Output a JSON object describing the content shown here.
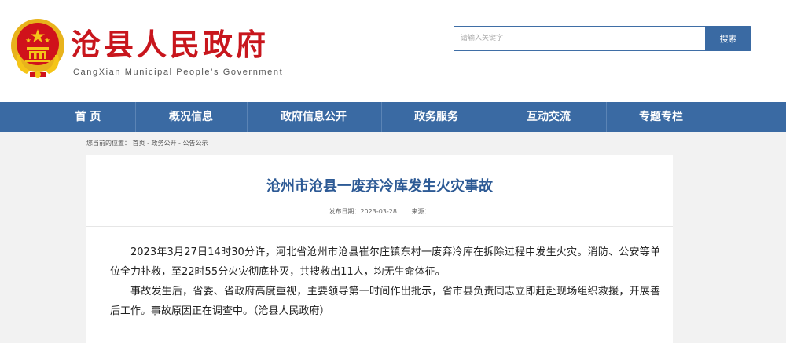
{
  "site": {
    "title": "沧县人民政府",
    "subtitle": "CangXian Municipal People’s Government"
  },
  "search": {
    "placeholder": "请输入关键字",
    "button_label": "搜索"
  },
  "nav": {
    "items": [
      "首 页",
      "概况信息",
      "政府信息公开",
      "政务服务",
      "互动交流",
      "专题专栏"
    ]
  },
  "breadcrumb": {
    "text": "您当前的位置： 首页 - 政务公开 - 公告公示"
  },
  "article": {
    "title": "沧州市沧县一废弃冷库发生火灾事故",
    "date_label": "发布日期：2023-03-28",
    "source_label": "来源：",
    "paragraphs": [
      "2023年3月27日14时30分许，河北省沧州市沧县崔尔庄镇东村一废弃冷库在拆除过程中发生火灾。消防、公安等单位全力扑救，至22时55分火灾彻底扑灭，共搜救出11人，均无生命体征。",
      "事故发生后，省委、省政府高度重视，主要领导第一时间作出批示，省市县负责同志立即赶赴现场组织救援，开展善后工作。事故原因正在调查中。（沧县人民政府）"
    ]
  },
  "colors": {
    "brand_red": "#c8161d",
    "nav_blue": "#3a6aa3",
    "title_blue": "#2d5a95",
    "emblem_gold": "#e8b31c"
  },
  "icons": {
    "emblem": "national-emblem-icon"
  }
}
